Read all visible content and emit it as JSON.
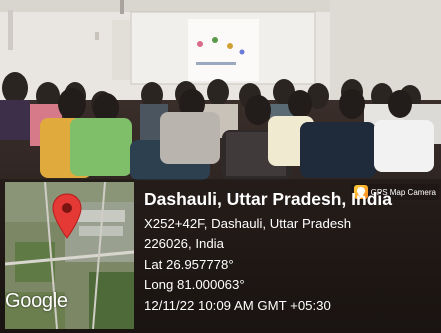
{
  "overlay": {
    "badge": {
      "icon": "map-pin-badge-icon",
      "text": "GPS Map Camera"
    },
    "map": {
      "brand": "Google",
      "pin_icon": "location-pin-icon"
    },
    "location": {
      "title": "Dashauli, Uttar Pradesh, India",
      "address_line1": "X252+42F, Dashauli, Uttar Pradesh",
      "address_line2": "226026, India",
      "latitude": "Lat 26.957778°",
      "longitude": "Long 81.000063°",
      "datetime": "12/11/22 10:09 AM GMT +05:30"
    }
  },
  "colors": {
    "wall": "#e9e6e1",
    "screen": "#f4f2ee",
    "pin": "#e53935",
    "overlay_text": "#ffffff"
  }
}
